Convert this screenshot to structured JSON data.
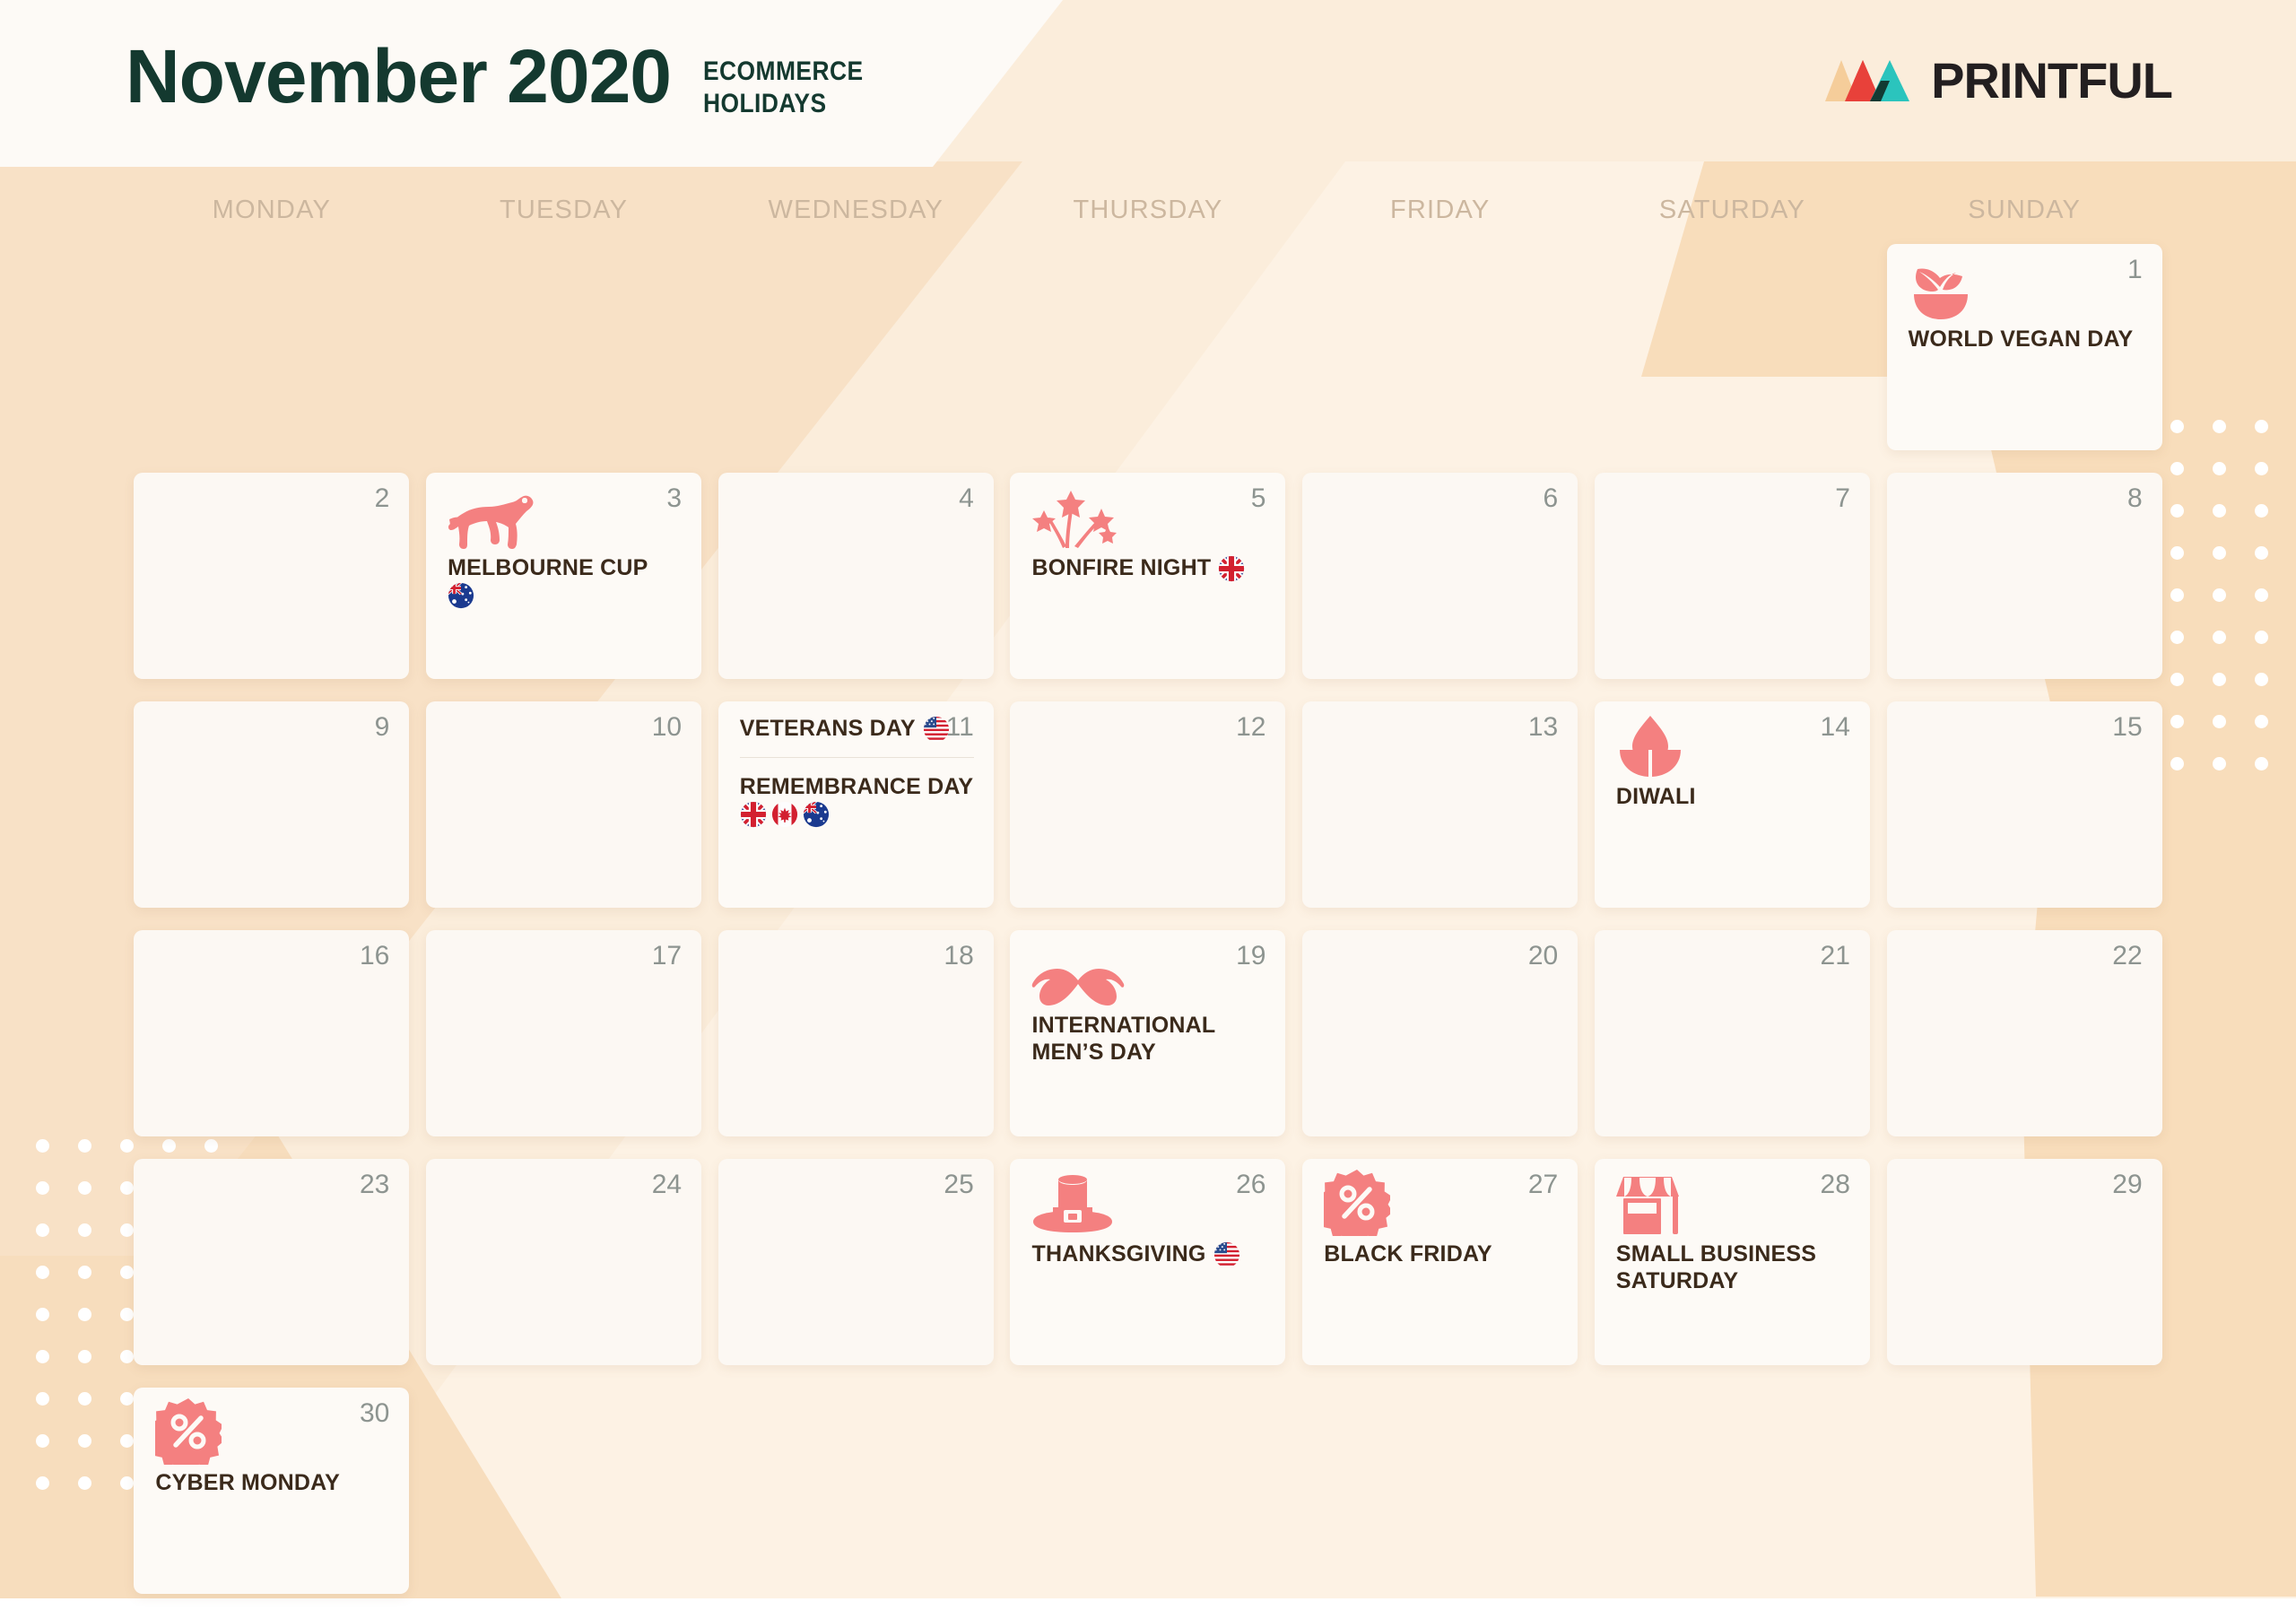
{
  "header": {
    "month": "November",
    "year": "2020",
    "subtitle_line1": "ECOMMERCE",
    "subtitle_line2": "HOLIDAYS",
    "title_color": "#14392f"
  },
  "logo": {
    "wordmark": "PRINTFUL",
    "mark_colors": [
      "#f5cd9a",
      "#e8413a",
      "#2bc4bd"
    ],
    "word_color": "#231f20"
  },
  "weekdays": [
    "MONDAY",
    "TUESDAY",
    "WEDNESDAY",
    "THURSDAY",
    "FRIDAY",
    "SATURDAY",
    "SUNDAY"
  ],
  "colors": {
    "accent_coral": "#f48080",
    "background_base": "#fbeddb",
    "background_light": "#fdf2e4",
    "background_dark": "#f7ddbd",
    "card": "#fdfaf6",
    "daynum": "#8d9490",
    "label": "#3b2a1b",
    "weekday": "#ccb79f"
  },
  "calendar": {
    "weeks": [
      [
        {
          "day": "",
          "blank": true
        },
        {
          "day": "",
          "blank": true
        },
        {
          "day": "",
          "blank": true
        },
        {
          "day": "",
          "blank": true
        },
        {
          "day": "",
          "blank": true
        },
        {
          "day": "",
          "blank": true
        },
        {
          "day": "1",
          "icon": "vegan-bowl-icon",
          "events": [
            {
              "label": "WORLD VEGAN DAY",
              "flags": []
            }
          ]
        }
      ],
      [
        {
          "day": "2",
          "events": []
        },
        {
          "day": "3",
          "icon": "horse-icon",
          "events": [
            {
              "label": "MELBOURNE CUP",
              "flags": [
                "au"
              ]
            }
          ]
        },
        {
          "day": "4",
          "events": []
        },
        {
          "day": "5",
          "icon": "fireworks-icon",
          "events": [
            {
              "label": "BONFIRE NIGHT",
              "flags": [
                "gb"
              ]
            }
          ]
        },
        {
          "day": "6",
          "events": []
        },
        {
          "day": "7",
          "events": []
        },
        {
          "day": "8",
          "events": []
        }
      ],
      [
        {
          "day": "9",
          "events": []
        },
        {
          "day": "10",
          "events": []
        },
        {
          "day": "11",
          "split": true,
          "events": [
            {
              "label": "VETERANS DAY",
              "flags": [
                "us"
              ]
            },
            {
              "label": "REMEMBRANCE DAY",
              "flags": [
                "gb",
                "ca",
                "au"
              ]
            }
          ]
        },
        {
          "day": "12",
          "events": []
        },
        {
          "day": "13",
          "events": []
        },
        {
          "day": "14",
          "icon": "diya-lamp-icon",
          "events": [
            {
              "label": "DIWALI",
              "flags": []
            }
          ]
        },
        {
          "day": "15",
          "events": []
        }
      ],
      [
        {
          "day": "16",
          "events": []
        },
        {
          "day": "17",
          "events": []
        },
        {
          "day": "18",
          "events": []
        },
        {
          "day": "19",
          "icon": "mustache-icon",
          "events": [
            {
              "label": "INTERNATIONAL MEN’S DAY",
              "flags": []
            }
          ]
        },
        {
          "day": "20",
          "events": []
        },
        {
          "day": "21",
          "events": []
        },
        {
          "day": "22",
          "events": []
        }
      ],
      [
        {
          "day": "23",
          "events": []
        },
        {
          "day": "24",
          "events": []
        },
        {
          "day": "25",
          "events": []
        },
        {
          "day": "26",
          "icon": "pilgrim-hat-icon",
          "events": [
            {
              "label": "THANKSGIVING",
              "flags": [
                "us"
              ]
            }
          ]
        },
        {
          "day": "27",
          "icon": "percent-badge-icon",
          "events": [
            {
              "label": "BLACK FRIDAY",
              "flags": []
            }
          ]
        },
        {
          "day": "28",
          "icon": "storefront-icon",
          "events": [
            {
              "label": "SMALL BUSINESS SATURDAY",
              "flags": []
            }
          ]
        },
        {
          "day": "29",
          "events": []
        }
      ],
      [
        {
          "day": "30",
          "icon": "percent-badge-icon",
          "events": [
            {
              "label": "CYBER MONDAY",
              "flags": []
            }
          ]
        },
        {
          "day": "",
          "blank": true
        },
        {
          "day": "",
          "blank": true
        },
        {
          "day": "",
          "blank": true
        },
        {
          "day": "",
          "blank": true
        },
        {
          "day": "",
          "blank": true
        },
        {
          "day": "",
          "blank": true
        }
      ]
    ]
  }
}
